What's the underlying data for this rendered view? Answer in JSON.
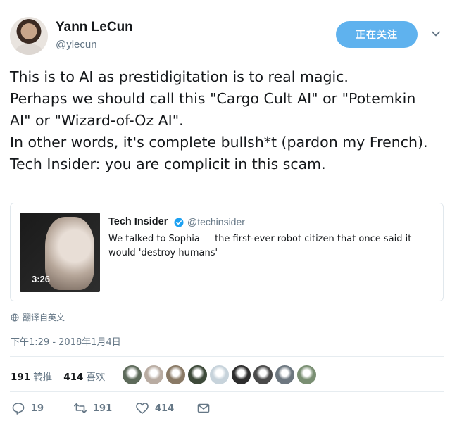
{
  "author": {
    "name": "Yann LeCun",
    "handle": "@ylecun"
  },
  "follow_button": {
    "label": "正在关注"
  },
  "tweet": {
    "lines": [
      "This is to AI as prestidigitation is to real magic.",
      "Perhaps we should call this \"Cargo Cult AI\" or \"Potemkin",
      "AI\" or \"Wizard-of-Oz AI\".",
      "In other words, it's complete bullsh*t (pardon my French).",
      "Tech Insider: you are complicit in this scam."
    ]
  },
  "quoted_tweet": {
    "author_name": "Tech Insider",
    "author_handle": "@techinsider",
    "text": "We talked to Sophia — the first-ever robot citizen that once said it would 'destroy humans'",
    "video_duration": "3:26"
  },
  "translate_label": "翻译自英文",
  "timestamp": "下午1:29 - 2018年1月4日",
  "stats": {
    "retweets_count": "191",
    "retweets_label": "转推",
    "likes_count": "414",
    "likes_label": "喜欢"
  },
  "liker_colors": [
    "#5d6a5a",
    "#b9aca2",
    "#8a7a66",
    "#3e4a3a",
    "#c7d3db",
    "#2d2d2d",
    "#4a4a4a",
    "#6d7780",
    "#7a8f73"
  ],
  "actions": {
    "reply_count": "19",
    "retweet_count": "191",
    "like_count": "414"
  },
  "colors": {
    "accent": "#5fb2ee",
    "muted": "#657786",
    "verified": "#1da1f2"
  }
}
